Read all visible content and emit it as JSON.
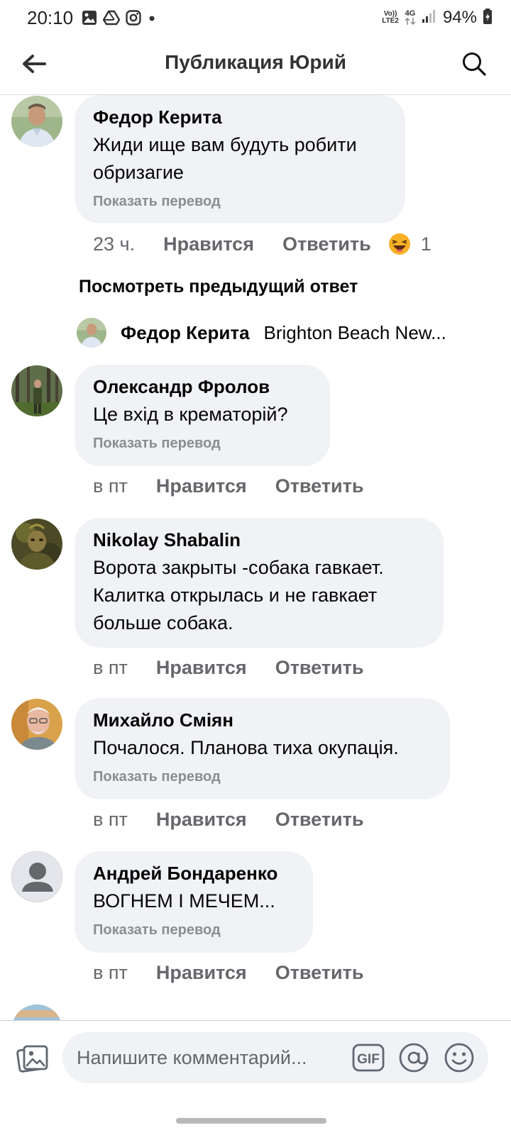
{
  "status_bar": {
    "time": "20:10",
    "network_top": "Vo))",
    "network_bottom": "LTE2",
    "data_type": "4G",
    "battery": "94%"
  },
  "header": {
    "title": "Публикация Юрий"
  },
  "comments": [
    {
      "author": "Федор Керита",
      "text": "Жиди ище вам будуть робити обризагие",
      "translate": "Показать перевод",
      "time": "23 ч.",
      "like": "Нравится",
      "reply": "Ответить",
      "reaction_count": "1"
    },
    {
      "author": "Олександр Фролов",
      "text": "Це вхід в крематорій?",
      "translate": "Показать перевод",
      "time": "в пт",
      "like": "Нравится",
      "reply": "Ответить"
    },
    {
      "author": "Nikolay Shabalin",
      "text": "Ворота закрыты -собака гавкает. Калитка открылась и не гавкает больше собака.",
      "time": "в пт",
      "like": "Нравится",
      "reply": "Ответить"
    },
    {
      "author": "Михайло Сміян",
      "text": "Почалося. Планова тиха окупація.",
      "translate": "Показать перевод",
      "time": "в пт",
      "like": "Нравится",
      "reply": "Ответить"
    },
    {
      "author": "Андрей Бондаренко",
      "text": "ВОГНЕМ І МЕЧЕМ...",
      "translate": "Показать перевод",
      "time": "в пт",
      "like": "Нравится",
      "reply": "Ответить"
    }
  ],
  "thread": {
    "view_previous": "Посмотреть предыдущий ответ",
    "reply_author": "Федор Керита",
    "reply_text": "Brighton Beach New..."
  },
  "composer": {
    "placeholder": "Напишите комментарий...",
    "gif_label": "GIF"
  },
  "icons": {
    "back": "arrow-left-icon",
    "search": "search-icon",
    "photo": "photo-icon",
    "gif": "gif-icon",
    "mention": "at-sign-icon",
    "emoji": "smiley-icon",
    "reaction": "haha-emoji-icon"
  },
  "colors": {
    "bubble": "#f0f2f5",
    "secondary_text": "#65676b",
    "translate_text": "#8a8d91"
  }
}
